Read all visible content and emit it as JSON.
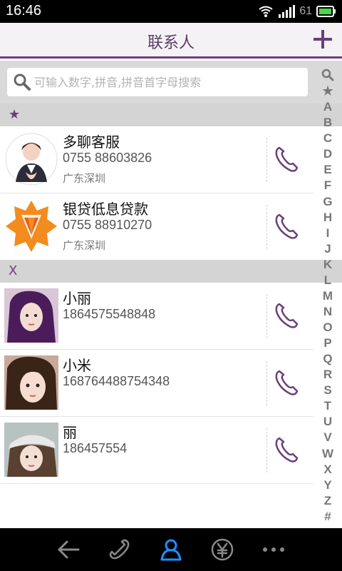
{
  "status_bar": {
    "time": "16:46",
    "battery": "61"
  },
  "header": {
    "title": "联系人"
  },
  "search": {
    "placeholder": "可输入数字,拼音,拼音首字母搜索"
  },
  "sections": [
    {
      "label": "★",
      "contacts": [
        {
          "name": "多聊客服",
          "phone": "0755 88603826",
          "location": "广东深圳"
        },
        {
          "name": "银贷低息贷款",
          "phone": "0755 88910270",
          "location": "广东深圳"
        }
      ]
    },
    {
      "label": "X",
      "contacts": [
        {
          "name": "小丽",
          "phone": "1864575548848"
        },
        {
          "name": "小米",
          "phone": "168764488754348"
        },
        {
          "name": "丽",
          "phone": "186457554"
        }
      ]
    }
  ],
  "alphabet_index": [
    "★",
    "A",
    "B",
    "C",
    "D",
    "E",
    "F",
    "G",
    "H",
    "I",
    "J",
    "K",
    "L",
    "M",
    "N",
    "O",
    "P",
    "Q",
    "R",
    "S",
    "T",
    "U",
    "V",
    "W",
    "X",
    "Y",
    "Z",
    "#"
  ],
  "colors": {
    "accent": "#6b3f7a",
    "active_nav": "#1e90ff"
  }
}
